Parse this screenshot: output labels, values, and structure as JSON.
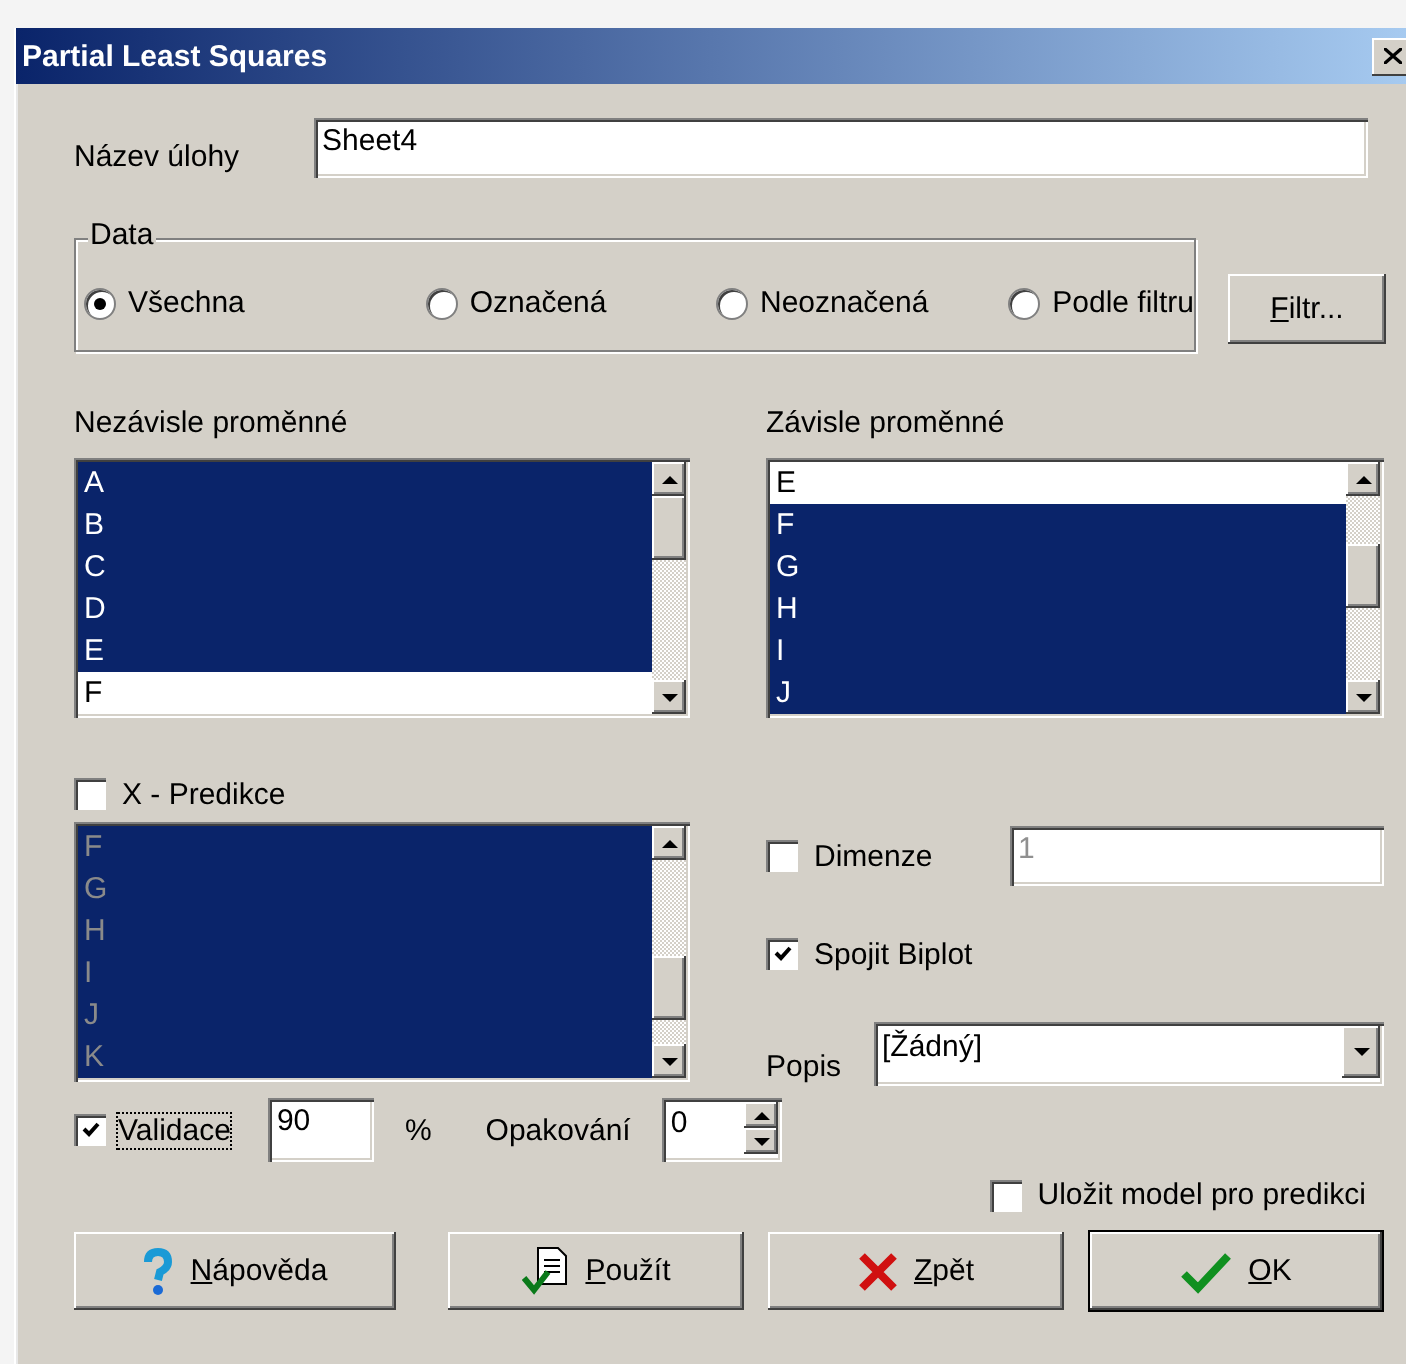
{
  "window": {
    "title": "Partial Least Squares"
  },
  "task_name": {
    "label": "Název úlohy",
    "value": "Sheet4"
  },
  "data_group": {
    "title": "Data",
    "options": [
      {
        "label": "Všechna",
        "selected": true
      },
      {
        "label": "Označená",
        "selected": false
      },
      {
        "label": "Neoznačená",
        "selected": false
      },
      {
        "label": "Podle filtru",
        "selected": false
      }
    ]
  },
  "filter_button": {
    "label": "Filtr...",
    "mnemonic": true
  },
  "independent": {
    "label": "Nezávisle proměnné",
    "items": [
      {
        "text": "A",
        "selected": true
      },
      {
        "text": "B",
        "selected": true
      },
      {
        "text": "C",
        "selected": true
      },
      {
        "text": "D",
        "selected": true
      },
      {
        "text": "E",
        "selected": true
      },
      {
        "text": "F",
        "selected": false
      }
    ]
  },
  "dependent": {
    "label": "Závisle proměnné",
    "items": [
      {
        "text": "E",
        "selected": false
      },
      {
        "text": "F",
        "selected": true
      },
      {
        "text": "G",
        "selected": true
      },
      {
        "text": "H",
        "selected": true
      },
      {
        "text": "I",
        "selected": true
      },
      {
        "text": "J",
        "selected": true
      }
    ]
  },
  "x_prediction": {
    "label": "X - Predikce",
    "checked": false,
    "list": {
      "disabled": true,
      "items": [
        {
          "text": "F",
          "selected": true
        },
        {
          "text": "G",
          "selected": true
        },
        {
          "text": "H",
          "selected": true
        },
        {
          "text": "I",
          "selected": true
        },
        {
          "text": "J",
          "selected": true
        },
        {
          "text": "K",
          "selected": true
        }
      ]
    }
  },
  "dimension": {
    "label": "Dimenze",
    "checked": false,
    "value": "1",
    "disabled": true
  },
  "join_biplot": {
    "label": "Spojit Biplot",
    "checked": true
  },
  "description": {
    "label": "Popis",
    "value": "[Žádný]"
  },
  "validation": {
    "label": "Validace",
    "checked": true,
    "focused": true,
    "value": "90",
    "unit": "%"
  },
  "repetitions": {
    "label": "Opakování",
    "value": "0"
  },
  "save_model": {
    "label": "Uložit model pro predikci",
    "checked": false
  },
  "buttons": [
    {
      "label": "Nápověda",
      "kind": "help",
      "mnemonic": true,
      "default": false
    },
    {
      "label": "Použít",
      "kind": "apply",
      "mnemonic": true,
      "default": false
    },
    {
      "label": "Zpět",
      "kind": "cancel",
      "mnemonic": true,
      "default": false
    },
    {
      "label": "OK",
      "kind": "ok",
      "mnemonic": true,
      "default": true
    }
  ]
}
